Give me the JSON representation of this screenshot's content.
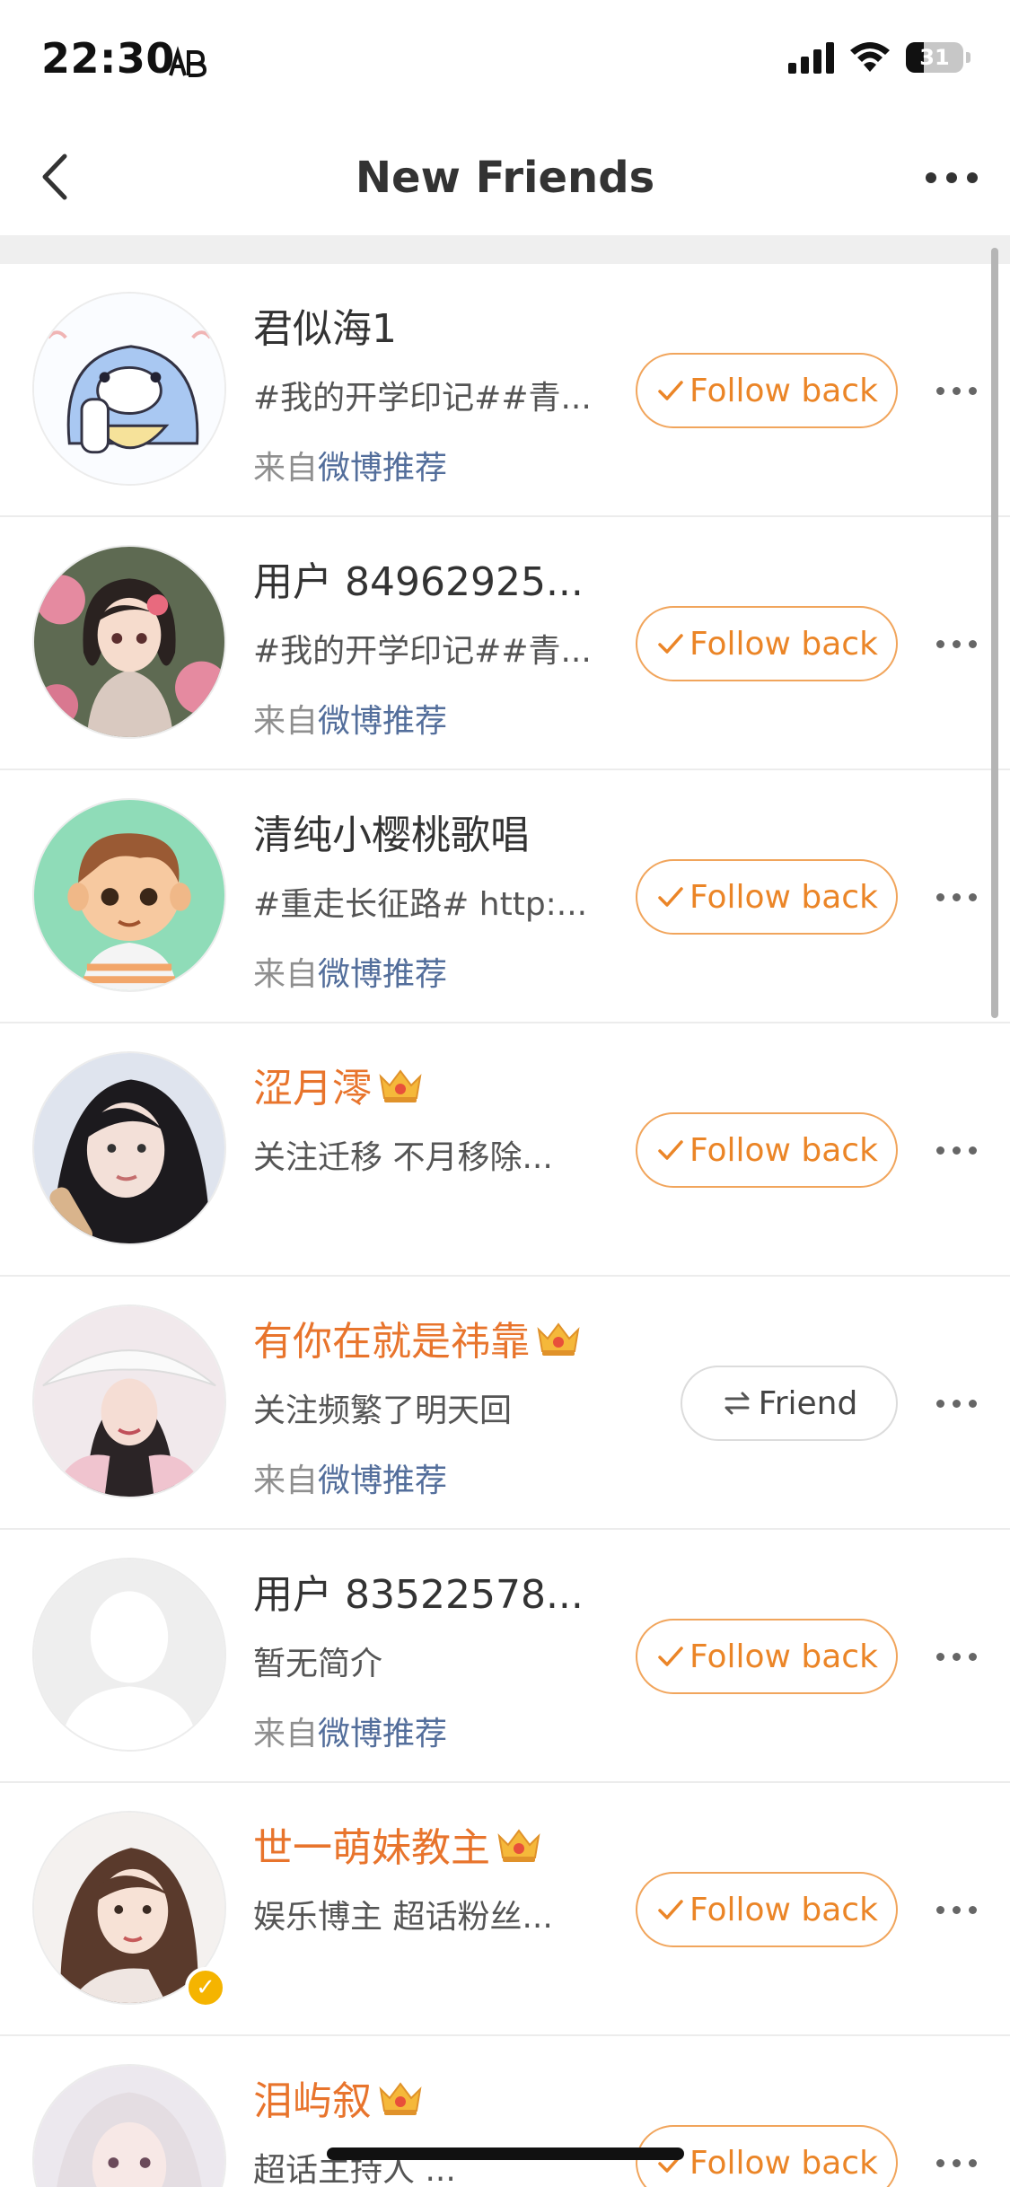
{
  "status_bar": {
    "time": "22:30",
    "battery": "31",
    "battery_level": 0.31
  },
  "nav": {
    "title": "New Friends",
    "back_icon": "chevron-left-icon",
    "more_icon": "more-horizontal-icon"
  },
  "friends": [
    {
      "name": "君似海1",
      "vip": false,
      "bio": "#我的开学印记##青...",
      "source_prefix": "来自",
      "source_link": "微博推荐",
      "action": "Follow back",
      "action_type": "follow",
      "avatar": "cartoon-dolphin"
    },
    {
      "name": "用户 84962925...",
      "vip": false,
      "bio": "#我的开学印记##青...",
      "source_prefix": "来自",
      "source_link": "微博推荐",
      "action": "Follow back",
      "action_type": "follow",
      "avatar": "anime-girl-flowers"
    },
    {
      "name": "清纯小樱桃歌唱",
      "vip": false,
      "bio": "#重走长征路# http:...",
      "source_prefix": "来自",
      "source_link": "微博推荐",
      "action": "Follow back",
      "action_type": "follow",
      "avatar": "cartoon-boy"
    },
    {
      "name": "涩月澪",
      "vip": true,
      "bio": "关注迁移 不月移除...",
      "source_prefix": "",
      "source_link": "",
      "action": "Follow back",
      "action_type": "follow",
      "avatar": "photo-girl-dark-hair"
    },
    {
      "name": "有你在就是祎靠",
      "vip": true,
      "bio": "关注频繁了明天回",
      "source_prefix": "来自",
      "source_link": "微博推荐",
      "action": "Friend",
      "action_type": "friend",
      "avatar": "photo-girl-hat"
    },
    {
      "name": "用户 83522578...",
      "vip": false,
      "bio": "暂无简介",
      "source_prefix": "来自",
      "source_link": "微博推荐",
      "action": "Follow back",
      "action_type": "follow",
      "avatar": "default-person"
    },
    {
      "name": "世一萌妹教主",
      "vip": true,
      "verified": true,
      "bio": "娱乐博主 超话粉丝...",
      "source_prefix": "",
      "source_link": "",
      "action": "Follow back",
      "action_type": "follow",
      "avatar": "photo-girl-brown-hair"
    },
    {
      "name": "泪屿叙",
      "vip": true,
      "bio": "超话主持人 ...",
      "source_prefix": "",
      "source_link": "",
      "action": "Follow back",
      "action_type": "follow",
      "avatar": "photo-girl-light-hair"
    }
  ],
  "colors": {
    "accent_orange": "#eb8527",
    "vip_name": "#e8742c",
    "link_blue": "#536e9b",
    "verified_badge": "#f5b400"
  }
}
